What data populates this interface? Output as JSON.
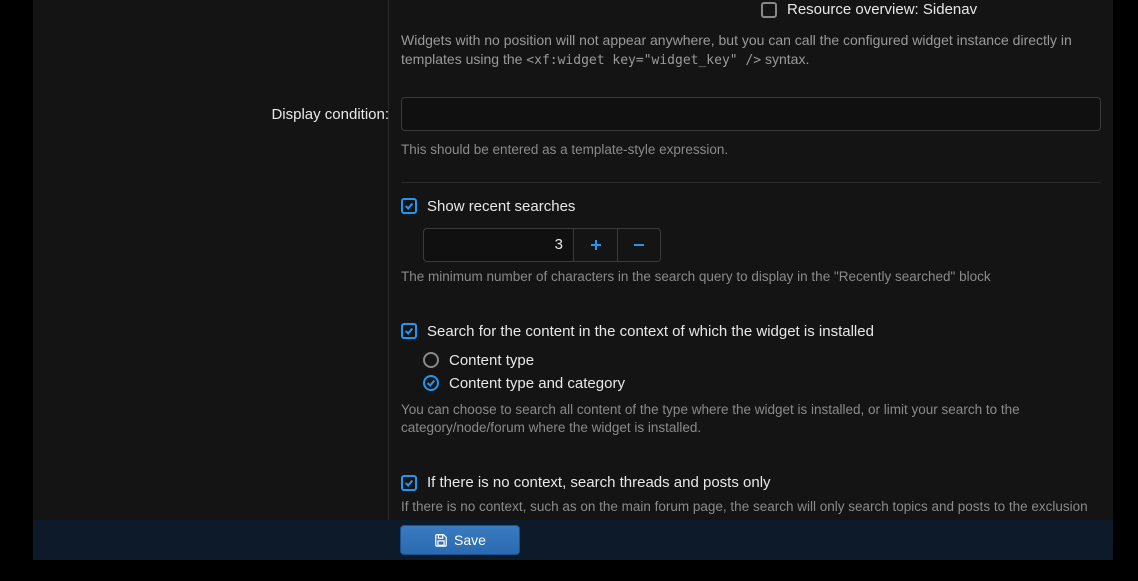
{
  "resource_overview": {
    "checkbox_label": "Resource overview: Sidenav",
    "checked": false
  },
  "widgets_note": {
    "before_code": "Widgets with no position will not appear anywhere, but you can call the configured widget instance directly in templates using the ",
    "code": "<xf:widget key=\"widget_key\" />",
    "after_code": " syntax."
  },
  "display_condition": {
    "label": "Display condition:",
    "value": "",
    "help": "This should be entered as a template-style expression."
  },
  "recent_searches": {
    "label": "Show recent searches",
    "checked": true,
    "value": "3",
    "help": "The minimum number of characters in the search query to display in the \"Recently searched\" block"
  },
  "context_search": {
    "label": "Search for the content in the context of which the widget is installed",
    "checked": true,
    "options": [
      {
        "label": "Content type",
        "selected": false
      },
      {
        "label": "Content type and category",
        "selected": true
      }
    ],
    "help": "You can choose to search all content of the type where the widget is installed, or limit your search to the category/node/forum where the widget is installed."
  },
  "no_context": {
    "label": "If there is no context, search threads and posts only",
    "checked": true,
    "help": "If there is no context, such as on the main forum page, the search will only search topics and posts to the exclusion of the rest of the content (resources, profile posts, direct messages, and others)."
  },
  "footer": {
    "save_label": "Save"
  }
}
